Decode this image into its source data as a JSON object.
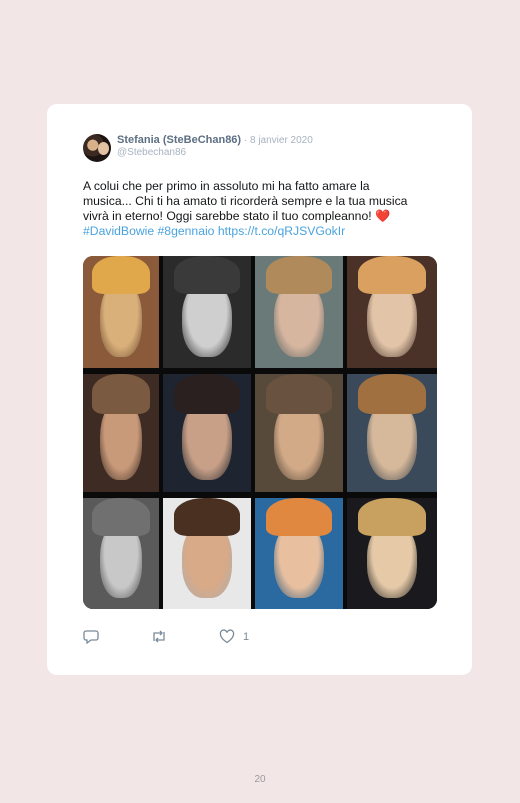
{
  "tweet": {
    "author_name": "Stefania (SteBeChan86)",
    "separator": " · ",
    "date": "8 janvier 2020",
    "handle": "@Stebechan86",
    "text_line1": "A colui che per primo in assoluto mi ha fatto amare la",
    "text_line2": "musica... Chi ti ha amato ti ricorderà sempre e la tua musica",
    "text_line3": "vivrà in eterno! Oggi sarebbe stato il tuo compleanno!",
    "heart_emoji": "❤️",
    "hashtag1": "#DavidBowie",
    "hashtag2": "#8gennaio",
    "link": "https://t.co/qRJSVGokIr",
    "like_count": "1",
    "icons": [
      "reply-icon",
      "retweet-icon",
      "like-icon"
    ]
  },
  "page": {
    "number": "20"
  },
  "colors": {
    "background": "#f3e6e6",
    "card": "#ffffff",
    "link": "#4aa3df",
    "heart": "#e0245e"
  }
}
